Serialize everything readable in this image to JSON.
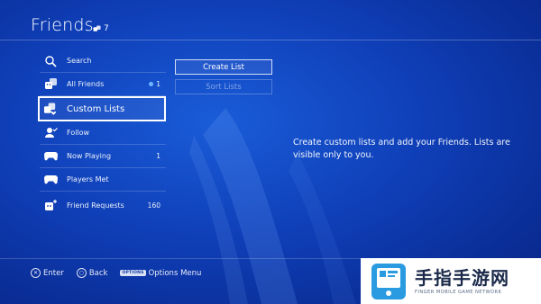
{
  "header": {
    "title": "Friends",
    "count": "7"
  },
  "sidebar": {
    "items": [
      {
        "label": "Search",
        "badge": ""
      },
      {
        "label": "All Friends",
        "badge": "1"
      },
      {
        "label": "Custom Lists",
        "badge": ""
      },
      {
        "label": "Follow",
        "badge": ""
      },
      {
        "label": "Now Playing",
        "badge": "1"
      },
      {
        "label": "Players Met",
        "badge": ""
      },
      {
        "label": "Friend Requests",
        "badge": "160"
      }
    ]
  },
  "main": {
    "create_list": "Create List",
    "sort_lists": "Sort Lists",
    "description": "Create custom lists and add your Friends. Lists are visible only to you."
  },
  "footer": {
    "enter": "Enter",
    "back": "Back",
    "options_button": "OPTIONS",
    "options_menu": "Options Menu"
  },
  "watermark": {
    "brand_cn": "手指手游网",
    "brand_en": "FINGER MOBILE GAME NETWORK"
  },
  "colors": {
    "background": "#0f3fb8",
    "accent": "#ffffff",
    "watermark_blue": "#2a9be0"
  }
}
